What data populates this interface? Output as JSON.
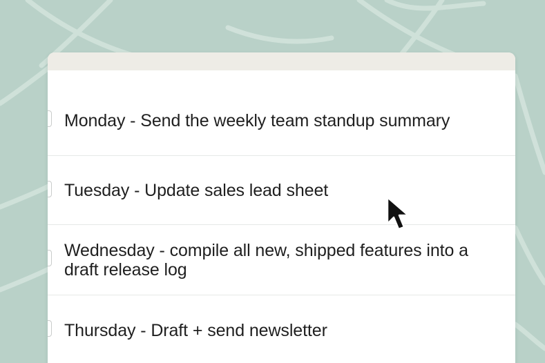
{
  "tasks": [
    {
      "label": "Monday - Send the weekly team standup summary",
      "checked": false
    },
    {
      "label": "Tuesday - Update sales lead sheet",
      "checked": false
    },
    {
      "label": "Wednesday - compile all new, shipped features into a draft release log",
      "checked": false
    },
    {
      "label": "Thursday - Draft + send newsletter",
      "checked": false
    }
  ],
  "colors": {
    "background": "#b9d1c8",
    "card": "#ffffff",
    "header": "#eeece6",
    "text": "#1f1f1f"
  },
  "icons": {
    "pointer": "mouse-pointer-icon",
    "checkbox": "checkbox-icon"
  }
}
